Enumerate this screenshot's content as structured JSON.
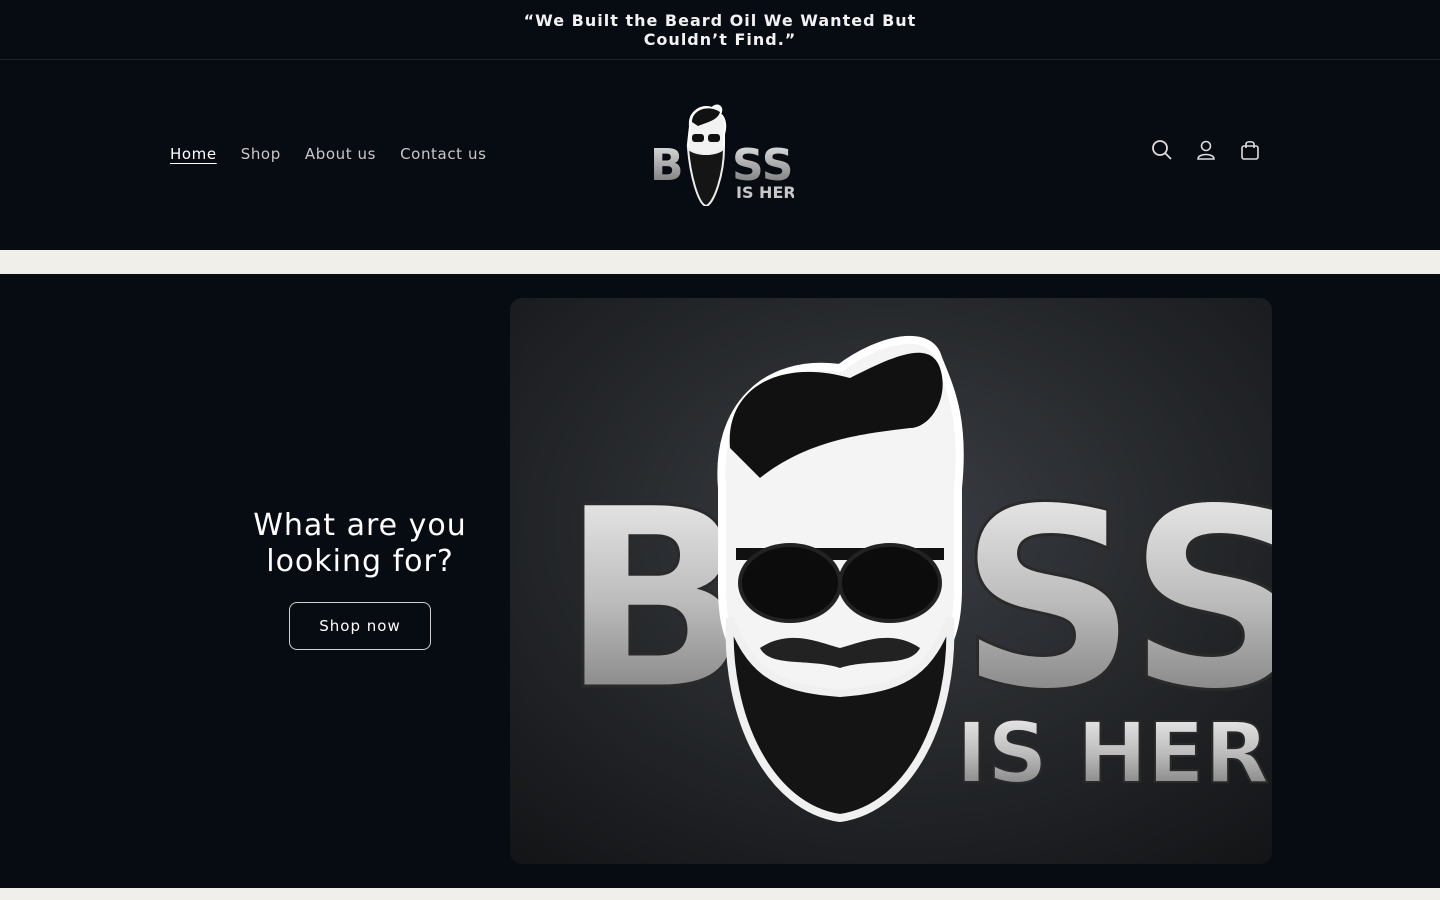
{
  "announcement": {
    "text": "“We Built the Beard Oil We Wanted But Couldn’t Find.”"
  },
  "header": {
    "nav": [
      {
        "label": "Home",
        "active": true
      },
      {
        "label": "Shop",
        "active": false
      },
      {
        "label": "About us",
        "active": false
      },
      {
        "label": "Contact us",
        "active": false
      }
    ],
    "logo": {
      "brand_text": "BOSS",
      "sub_text": "IS HERE"
    },
    "icons": [
      "search-icon",
      "account-icon",
      "cart-icon"
    ]
  },
  "hero": {
    "heading": "What are you looking for?",
    "button_label": "Shop now",
    "image": {
      "brand_text": "BOSS",
      "sub_text": "IS HERE"
    }
  },
  "colors": {
    "background": "#070b12",
    "strip": "#f0efea",
    "text": "#ffffff"
  }
}
